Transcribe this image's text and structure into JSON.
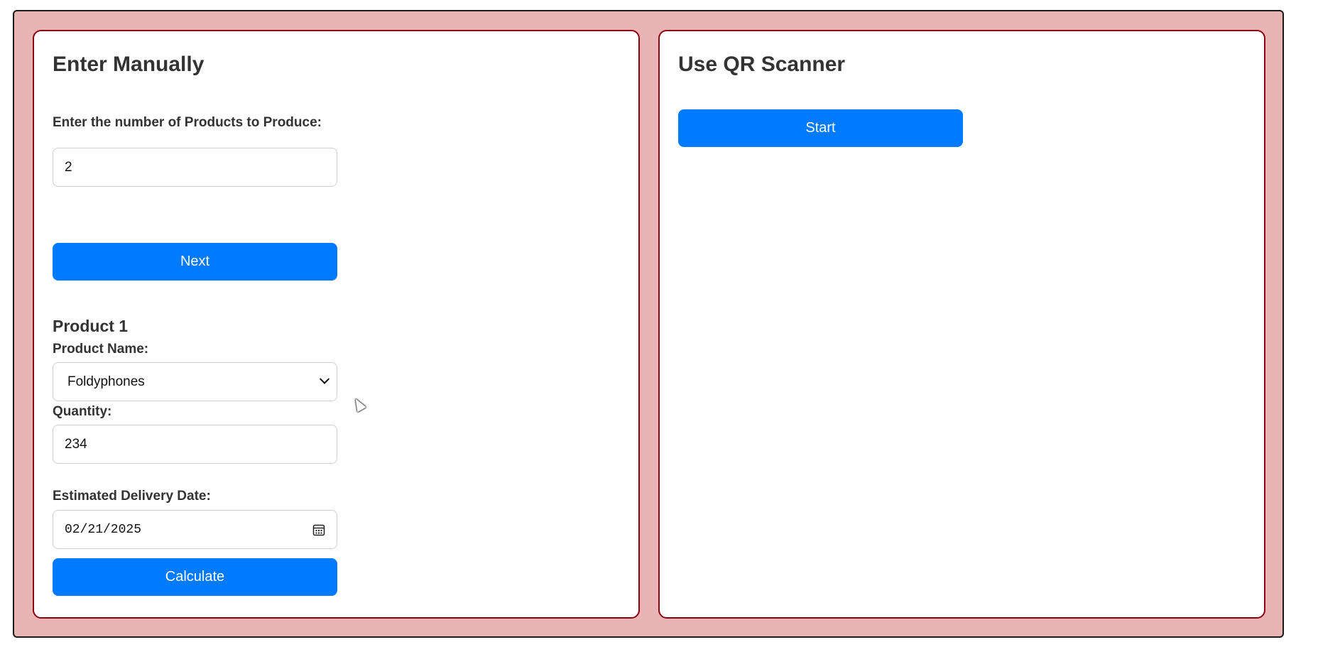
{
  "manual": {
    "title": "Enter Manually",
    "count_label": "Enter the number of Products to Produce:",
    "count_value": "2",
    "next_label": "Next",
    "product": {
      "heading": "Product 1",
      "name_label": "Product Name:",
      "name_value": "Foldyphones",
      "quantity_label": "Quantity:",
      "quantity_value": "234",
      "date_label": "Estimated Delivery Date:",
      "date_value": "02/21/2025"
    },
    "calculate_label": "Calculate"
  },
  "qr": {
    "title": "Use QR Scanner",
    "start_label": "Start"
  },
  "colors": {
    "background": "#e8b4b4",
    "panel_border": "#8b0010",
    "button": "#007bff"
  },
  "icons": {
    "select": "chevron-down-icon",
    "date": "calendar-icon"
  }
}
